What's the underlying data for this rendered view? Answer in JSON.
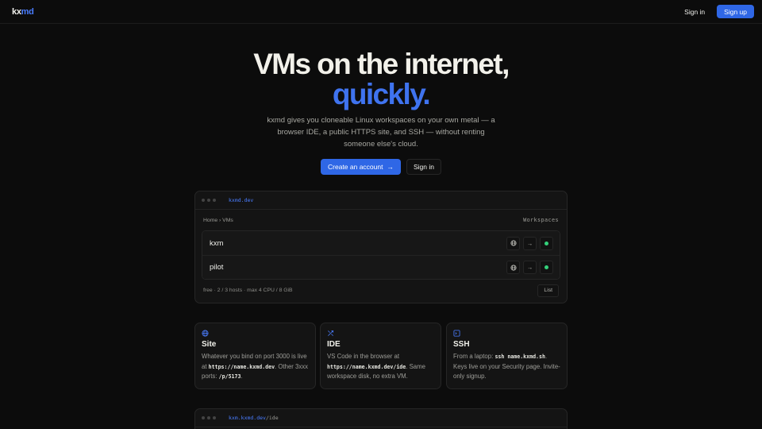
{
  "nav": {
    "logo_main": "kx",
    "logo_accent": "md",
    "signin_label": "Sign in",
    "signup_label": "Sign up"
  },
  "hero": {
    "title_line1": "VMs on the internet,",
    "title_line2": "quickly.",
    "subtitle": "kxmd gives you cloneable Linux workspaces on your own metal — a browser IDE, a public HTTPS site, and SSH — without renting someone else's cloud.",
    "create_account_label": "Create an account",
    "create_account_icon": "arrow-right-icon",
    "signin_label": "Sign in"
  },
  "window1": {
    "url": "kxmd.dev",
    "url_path": "",
    "breadcrumb": "Home › VMs",
    "section_label": "Workspaces",
    "vms": [
      {
        "name": "kxm",
        "status": "running",
        "status_color": "#34d17b"
      },
      {
        "name": "pilot",
        "status": "running",
        "status_color": "#34d17b"
      }
    ],
    "footer_text": "free · 2 / 3 hosts · max 4 CPU / 8 GiB",
    "list_label": "List"
  },
  "cards": [
    {
      "icon": "globe-icon",
      "title": "Site",
      "body_pre": "Whatever you bind on port 3000 is live at ",
      "code1": "https://name.kxmd.dev",
      "body_mid": ". Other 3xxx ports: ",
      "code2": "/p/5173",
      "body_post": "."
    },
    {
      "icon": "ide-icon",
      "title": "IDE",
      "body_pre": "VS Code in the browser at ",
      "code1": "https://name.kxmd.dev/ide",
      "body_mid": ". Same workspace disk, no extra VM.",
      "code2": "",
      "body_post": ""
    },
    {
      "icon": "terminal-icon",
      "title": "SSH",
      "body_pre": "From a laptop: ",
      "code1": "ssh name.kxmd.sh",
      "body_mid": ". Keys live on your Security page. Invite-only signup.",
      "code2": "",
      "body_post": ""
    }
  ],
  "window2": {
    "url": "kxm.kxmd.dev",
    "url_path": "/ide"
  },
  "colors": {
    "accent": "#2f67e6",
    "background": "#0c0c0c",
    "status_running": "#34d17b"
  }
}
